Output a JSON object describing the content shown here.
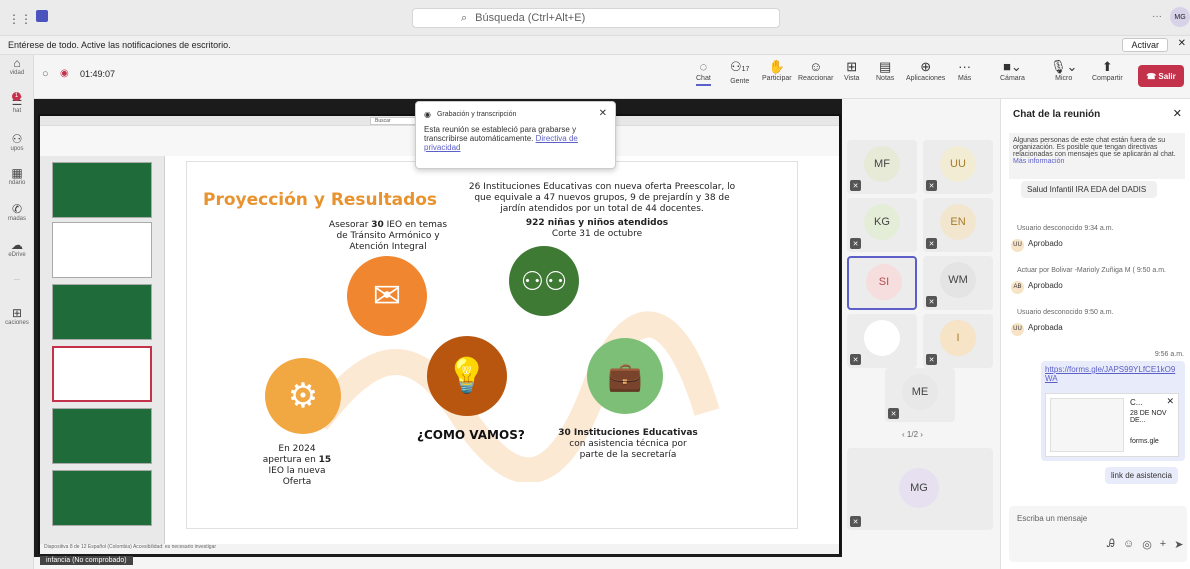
{
  "titlebar": {
    "search_placeholder": "Búsqueda (Ctrl+Alt+E)",
    "user_initials": "MG",
    "more": "···"
  },
  "notice": {
    "text": "Entérese de todo. Active las notificaciones de escritorio.",
    "button": "Activar"
  },
  "rail": [
    {
      "label": "vidad",
      "icon": "bell-icon"
    },
    {
      "label": "hat",
      "icon": "chat-icon",
      "badge": "1"
    },
    {
      "label": "upos",
      "icon": "teams-icon"
    },
    {
      "label": "ndario",
      "icon": "calendar-icon"
    },
    {
      "label": "madas",
      "icon": "call-icon"
    },
    {
      "label": "eDrive",
      "icon": "cloud-icon"
    },
    {
      "label": "···",
      "icon": "more-icon"
    },
    {
      "label": "caciones",
      "icon": "apps-icon"
    }
  ],
  "meeting": {
    "timer": "01:49:07",
    "tools": [
      {
        "label": "Chat",
        "icon": "chat-icon"
      },
      {
        "label": "Gente",
        "icon": "people-icon",
        "count": "17"
      },
      {
        "label": "Participar",
        "icon": "hand-icon"
      },
      {
        "label": "Reaccionar",
        "icon": "smile-icon"
      },
      {
        "label": "Vista",
        "icon": "grid-icon"
      },
      {
        "label": "Notas",
        "icon": "notes-icon"
      },
      {
        "label": "Aplicaciones",
        "icon": "plus-icon"
      },
      {
        "label": "Más",
        "icon": "more-icon"
      },
      {
        "label": "Cámara",
        "icon": "camera-icon"
      },
      {
        "label": "Micro",
        "icon": "mic-icon"
      },
      {
        "label": "Compartir",
        "icon": "share-icon"
      }
    ],
    "leave": "Salir"
  },
  "popup": {
    "title": "Grabación y transcripción",
    "body": "Esta reunión se estableció para grabarse y transcribirse automáticamente. ",
    "link": "Directiva de privacidad"
  },
  "slide": {
    "title": "Proyección y Resultados",
    "center": "¿COMO VAMOS?",
    "t1a": "Asesorar ",
    "t1b": "30",
    "t1c": " IEO en temas",
    "t1d": "de Tránsito Armónico y",
    "t1e": "Atención Integral",
    "t2": "26 Instituciones Educativas con nueva oferta Preescolar, lo que equivale a 47 nuevos grupos, 9 de prejardín y 38 de jardín atendidos por un total de 44 docentes.",
    "t3": "922 niñas y niños atendidos",
    "t4": "Corte 31 de octubre",
    "t5a": "En 2024",
    "t5b": "apertura en ",
    "t5c": "15",
    "t5d": "IEO la nueva",
    "t5e": "Oferta",
    "t6a": "30 Instituciones Educativas",
    "t6b": "con asistencia técnica por",
    "t6c": "parte de la secretaría"
  },
  "ppt": {
    "search": "Buscar",
    "statusbar": "Diapositiva 8 de 12   Español (Colombia)   Accesibilidad: es necesario investigar"
  },
  "participants": [
    {
      "initials": "MF",
      "color": "#e8ead8"
    },
    {
      "initials": "UU",
      "color": "#f3ecd4"
    },
    {
      "initials": "KG",
      "color": "#e4edd8"
    },
    {
      "initials": "EN",
      "color": "#f3e6cf"
    },
    {
      "initials": "SI",
      "color": "#f6dede"
    },
    {
      "initials": "WM",
      "color": "#e4e4e4"
    },
    {
      "initials": "",
      "color": "#ffffff"
    },
    {
      "initials": "I",
      "color": "#f7e3c5"
    },
    {
      "initials": "ME",
      "color": "#e8e8e8"
    },
    {
      "initials": "MG",
      "color": "#e6e0f0"
    }
  ],
  "pager": "1/2",
  "self_label": "infancia (No comprobado)",
  "chat": {
    "title": "Chat de la reunión",
    "warning": "Algunas personas de este chat están fuera de su organización. Es posible que tengan directivas relacionadas con mensajes que se aplicarán al chat.",
    "warning_link": "Más información",
    "bubble1": "Salud Infantil IRA EDA del DADIS",
    "m1_meta": "Usuario desconocido  9:34 a.m.",
    "m1_tag": "UU",
    "m1_text": "Aprobado",
    "m2_meta": "Actuar por Bolivar -Marioly Zuñiga M (  9:50 a.m.",
    "m2_tag": "AB",
    "m2_text": "Aprobado",
    "m3_meta": "Usuario desconocido  9:50 a.m.",
    "m3_tag": "UU",
    "m3_text": "Aprobada",
    "time4": "9:56 a.m.",
    "link": "https://forms.gle/JAPS99YLfCE1kO9WA",
    "card_title": "C...",
    "card_date": "28 DE NOV DE...",
    "card_site": "forms.gle",
    "bubble5": "link de asistencia",
    "compose_placeholder": "Escriba un mensaje"
  }
}
